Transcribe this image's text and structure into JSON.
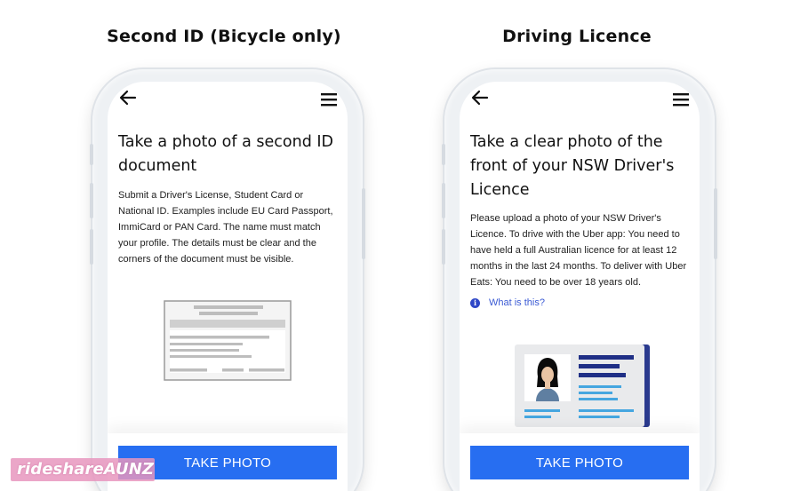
{
  "panels": [
    {
      "title": "Second ID (Bicycle only)",
      "heading": "Take a photo of a second ID document",
      "body": "Submit a Driver's License, Student Card or National ID. Examples include EU Card Passport, ImmiCard or PAN Card. The name must match your profile. The details must be clear and the corners of the document must be visible.",
      "button_label": "TAKE PHOTO",
      "icons": {
        "back": "arrow-left-icon",
        "menu": "hamburger-menu-icon"
      }
    },
    {
      "title": "Driving Licence",
      "heading": "Take a clear photo of the front of your NSW Driver's Licence",
      "body": "Please upload a photo of your NSW Driver's Licence. To drive with the Uber app: You need to have held a full Australian licence for at least 12 months in the last 24 months. To deliver with Uber Eats: You need to be over 18 years old.",
      "help_link": "What is this?",
      "button_label": "TAKE PHOTO",
      "icons": {
        "back": "arrow-left-icon",
        "menu": "hamburger-menu-icon",
        "info": "info-icon"
      }
    }
  ],
  "watermark": "rideshareAUNZ",
  "colors": {
    "button": "#276ef1",
    "link": "#3a5ad4",
    "licence_dark": "#1f2f86",
    "licence_light": "#45a6e0"
  }
}
